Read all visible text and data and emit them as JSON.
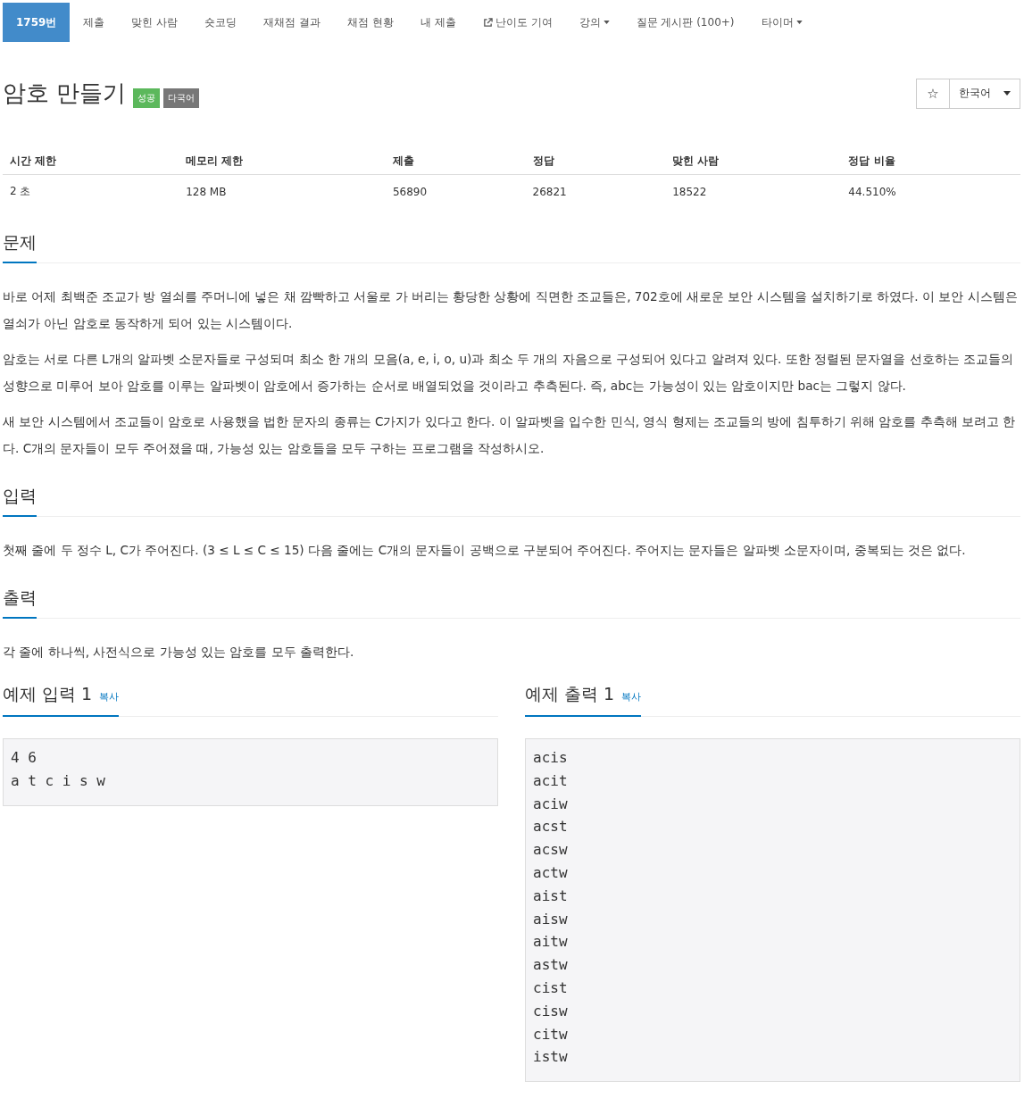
{
  "nav": {
    "items": [
      {
        "label": "1759번",
        "selected": true,
        "kind": "link"
      },
      {
        "label": "제출",
        "selected": false,
        "kind": "link"
      },
      {
        "label": "맞힌 사람",
        "selected": false,
        "kind": "link"
      },
      {
        "label": "숏코딩",
        "selected": false,
        "kind": "link"
      },
      {
        "label": "재채점 결과",
        "selected": false,
        "kind": "link"
      },
      {
        "label": "채점 현황",
        "selected": false,
        "kind": "link"
      },
      {
        "label": "내 제출",
        "selected": false,
        "kind": "link"
      },
      {
        "label": "난이도 기여",
        "selected": false,
        "kind": "external"
      },
      {
        "label": "강의",
        "selected": false,
        "kind": "dropdown"
      },
      {
        "label": "질문 게시판 (100+)",
        "selected": false,
        "kind": "link"
      },
      {
        "label": "타이머",
        "selected": false,
        "kind": "dropdown"
      }
    ]
  },
  "title": "암호 만들기",
  "badges": [
    {
      "label": "성공",
      "color": "#5cb85c"
    },
    {
      "label": "다국어",
      "color": "#777777"
    }
  ],
  "star_button": "☆",
  "language": "한국어",
  "stats": {
    "columns": [
      "시간 제한",
      "메모리 제한",
      "제출",
      "정답",
      "맞힌 사람",
      "정답 비율"
    ],
    "rows": [
      [
        "2 초",
        "128 MB",
        "56890",
        "26821",
        "18522",
        "44.510%"
      ]
    ]
  },
  "sections": [
    {
      "heading": "문제",
      "paragraphs": [
        "바로 어제 최백준 조교가 방 열쇠를 주머니에 넣은 채 깜빡하고 서울로 가 버리는 황당한 상황에 직면한 조교들은, 702호에 새로운 보안 시스템을 설치하기로 하였다. 이 보안 시스템은 열쇠가 아닌 암호로 동작하게 되어 있는 시스템이다.",
        "암호는 서로 다른 L개의 알파벳 소문자들로 구성되며 최소 한 개의 모음(a, e, i, o, u)과 최소 두 개의 자음으로 구성되어 있다고 알려져 있다. 또한 정렬된 문자열을 선호하는 조교들의 성향으로 미루어 보아 암호를 이루는 알파벳이 암호에서 증가하는 순서로 배열되었을 것이라고 추측된다. 즉, abc는 가능성이 있는 암호이지만 bac는 그렇지 않다.",
        "새 보안 시스템에서 조교들이 암호로 사용했을 법한 문자의 종류는 C가지가 있다고 한다. 이 알파벳을 입수한 민식, 영식 형제는 조교들의 방에 침투하기 위해 암호를 추측해 보려고 한다. C개의 문자들이 모두 주어졌을 때, 가능성 있는 암호들을 모두 구하는 프로그램을 작성하시오."
      ]
    },
    {
      "heading": "입력",
      "paragraphs": [
        "첫째 줄에 두 정수 L, C가 주어진다. (3 ≤ L ≤ C ≤ 15) 다음 줄에는 C개의 문자들이 공백으로 구분되어 주어진다. 주어지는 문자들은 알파벳 소문자이며, 중복되는 것은 없다."
      ]
    },
    {
      "heading": "출력",
      "paragraphs": [
        "각 줄에 하나씩, 사전식으로 가능성 있는 암호를 모두 출력한다."
      ]
    }
  ],
  "samples": [
    {
      "heading": "예제 입력 1",
      "copy_label": "복사",
      "lines": [
        "4 6",
        "a t c i s w"
      ]
    },
    {
      "heading": "예제 출력 1",
      "copy_label": "복사",
      "lines": [
        "acis",
        "acit",
        "aciw",
        "acst",
        "acsw",
        "actw",
        "aist",
        "aisw",
        "aitw",
        "astw",
        "cist",
        "cisw",
        "citw",
        "istw"
      ]
    }
  ]
}
